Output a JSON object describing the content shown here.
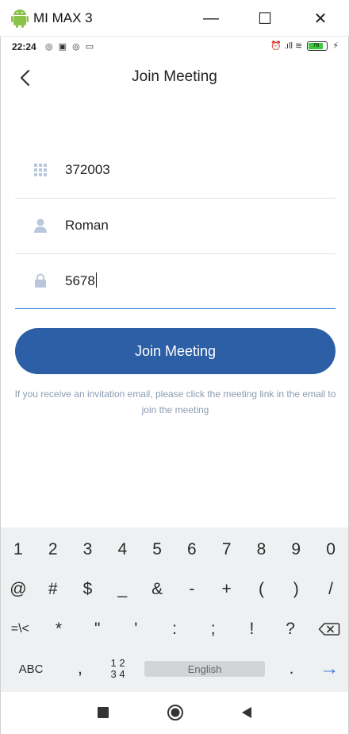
{
  "window": {
    "title": "MI MAX 3",
    "minimize_glyph": "—",
    "maximize_glyph": "☐",
    "close_glyph": "✕"
  },
  "statusbar": {
    "time": "22:24",
    "left_icons": "◎ ▣ ◎ ▭",
    "right_icons": "⏰ .ıll ≋",
    "battery_level": "78"
  },
  "header": {
    "title": "Join Meeting",
    "back_icon": "chevron-left-icon"
  },
  "form": {
    "meeting_id": {
      "value": "372003",
      "icon": "grid-icon"
    },
    "name": {
      "value": "Roman",
      "icon": "person-icon"
    },
    "password": {
      "value": "5678",
      "icon": "lock-icon"
    }
  },
  "join_button": {
    "label": "Join Meeting",
    "color": "#2d5fa6"
  },
  "hint": "If you receive an invitation email, please click the meeting link in the email to join the meeting",
  "keyboard": {
    "row1": [
      "1",
      "2",
      "3",
      "4",
      "5",
      "6",
      "7",
      "8",
      "9",
      "0"
    ],
    "row2": [
      "@",
      "#",
      "$",
      "_",
      "&",
      "-",
      "+",
      "(",
      ")",
      "/"
    ],
    "row3": [
      "=\\<",
      "*",
      "\"",
      "'",
      ":",
      ";",
      "!",
      "?"
    ],
    "abc_label": "ABC",
    "comma_label": ",",
    "numtoggle_line1": "1 2",
    "numtoggle_line2": "3 4",
    "space_label": "English",
    "period_label": ".",
    "enter_glyph": "→"
  },
  "colors": {
    "accent": "#2d5fa6",
    "field_active": "#4a8fd6",
    "hint": "#8a9bb1",
    "keyboard_bg": "#eef0f2"
  }
}
